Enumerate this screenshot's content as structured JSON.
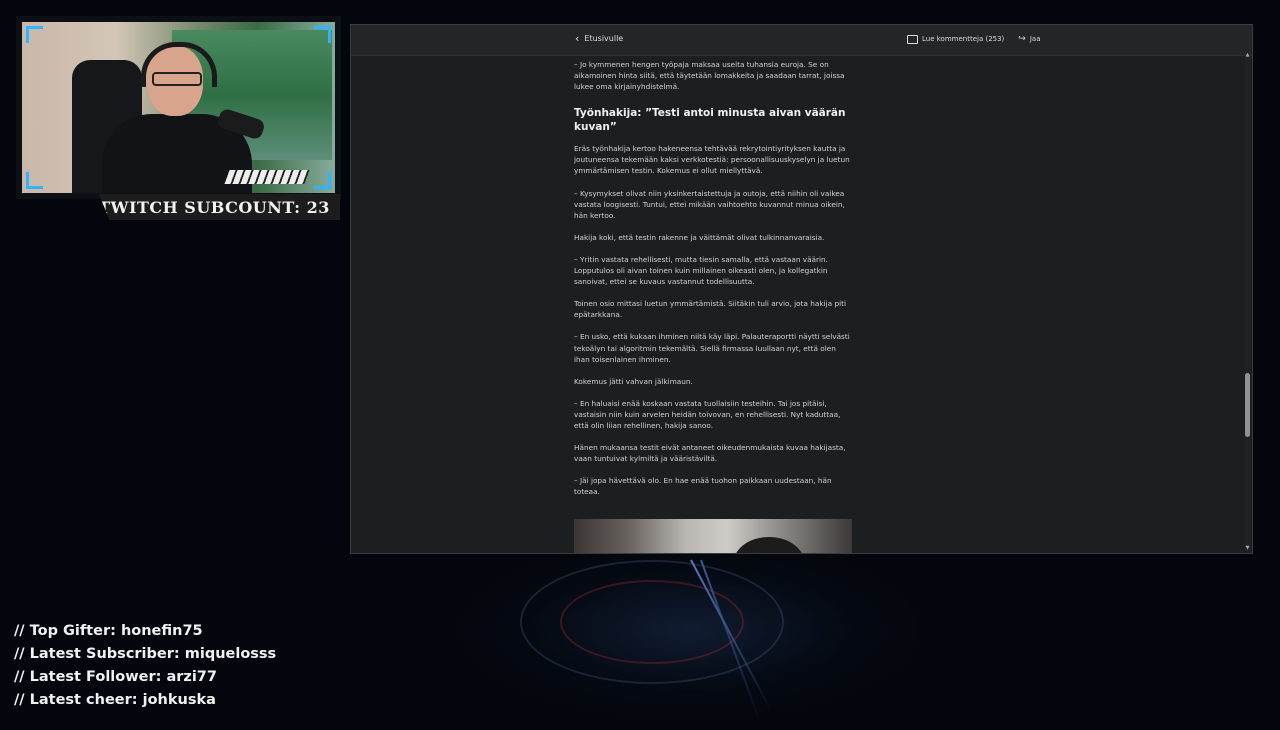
{
  "overlay": {
    "subcount": "TWITCH SUBCOUNT: 23",
    "stats": {
      "top_gifter": "// Top Gifter: honefin75",
      "latest_subscriber": "// Latest Subscriber: miquelosss",
      "latest_follower": "// Latest Follower: arzi77",
      "latest_cheer": "// Latest cheer: johkuska"
    },
    "accent_color": "#2fb5ff"
  },
  "browser": {
    "nav": {
      "back_label": "Etusivulle",
      "comments_label": "Lue kommentteja (253)",
      "share_label": "Jaa"
    },
    "article": {
      "p0": "– Jo kymmenen hengen työpaja maksaa useita tuhansia euroja. Se on aikamoinen hinta siitä, että täytetään lomakkeita ja saadaan tarrat, joissa lukee oma kirjainyhdistelmä.",
      "heading": "Työnhakija: ”Testi antoi minusta aivan väärän kuvan”",
      "p1": "Eräs työnhakija kertoo hakeneensa tehtävää rekrytointiyrityksen kautta ja joutuneensa tekemään kaksi verkkotestiä: persoonallisuuskyselyn ja luetun ymmärtämisen testin. Kokemus ei ollut miellyttävä.",
      "p2": "– Kysymykset olivat niin yksinkertaistettuja ja outoja, että niihin oli vaikea vastata loogisesti. Tuntui, ettei mikään vaihtoehto kuvannut minua oikein, hän kertoo.",
      "p3": "Hakija koki, että testin rakenne ja väittämät olivat tulkinnanvaraisia.",
      "p4": "– Yritin vastata rehellisesti, mutta tiesin samalla, että vastaan väärin. Lopputulos oli aivan toinen kuin millainen oikeasti olen, ja kollegatkin sanoivat, ettei se kuvaus vastannut todellisuutta.",
      "p5": "Toinen osio mittasi luetun ymmärtämistä. Siitäkin tuli arvio, jota hakija piti epätarkkana.",
      "p6": "– En usko, että kukaan ihminen niitä käy läpi. Palauteraportti näytti selvästi tekoälyn tai algoritmin tekemältä. Siellä firmassa luullaan nyt, että olen ihan toisenlainen ihminen.",
      "p7": "Kokemus jätti vahvan jälkimaun.",
      "p8": "– En haluaisi enää koskaan vastata tuollaisiin testeihin. Tai jos pitäisi, vastaisin niin kuin arvelen heidän toivovan, en rehellisesti. Nyt kaduttaa, että olin liian rehellinen, hakija sanoo.",
      "p9": "Hänen mukaansa testit eivät antaneet oikeudenmukaista kuvaa hakijasta, vaan tuntuivat kylmiltä ja vääristäviltä.",
      "p10": "– Jäi jopa hävettävä olo. En hae enää tuohon paikkaan uudestaan, hän toteaa."
    }
  }
}
